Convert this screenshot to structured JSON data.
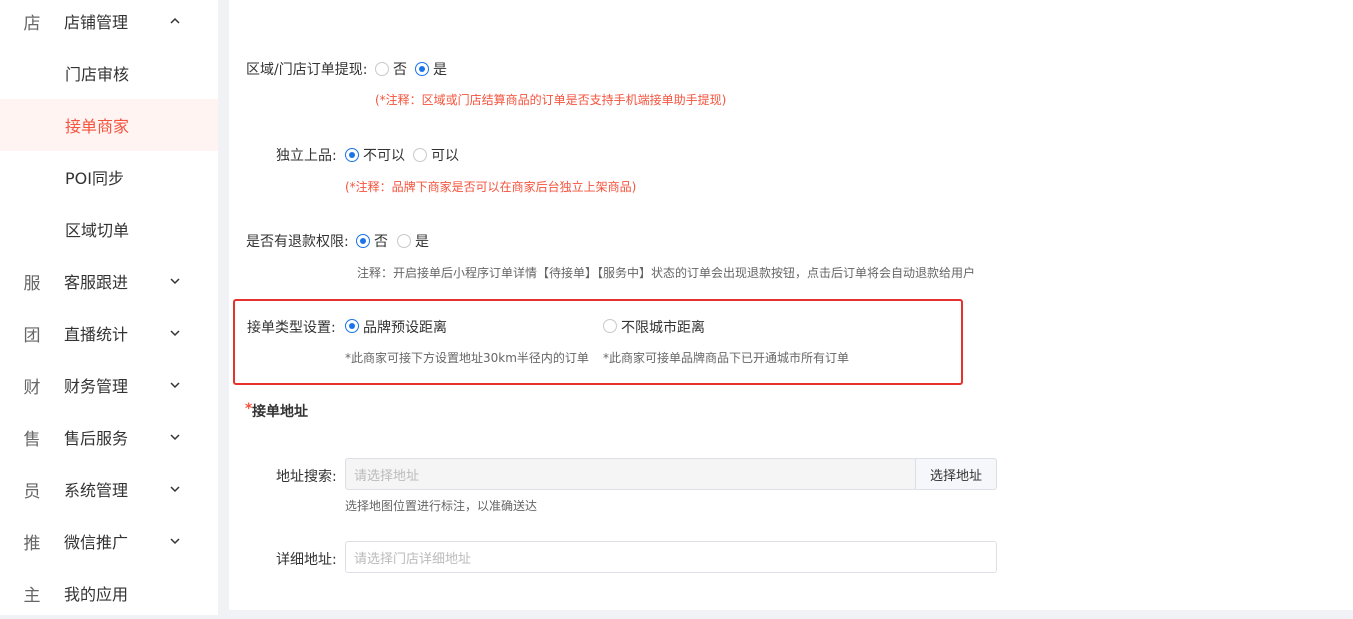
{
  "sidebar": {
    "items": [
      {
        "glyph": "店",
        "label": "店铺管理",
        "chevron": "up"
      },
      {
        "label": "门店审核"
      },
      {
        "label": "接单商家",
        "active": true
      },
      {
        "label": "POI同步"
      },
      {
        "label": "区域切单"
      },
      {
        "glyph": "服",
        "label": "客服跟进",
        "chevron": "down"
      },
      {
        "glyph": "团",
        "label": "直播统计",
        "chevron": "down"
      },
      {
        "glyph": "财",
        "label": "财务管理",
        "chevron": "down"
      },
      {
        "glyph": "售",
        "label": "售后服务",
        "chevron": "down"
      },
      {
        "glyph": "员",
        "label": "系统管理",
        "chevron": "down"
      },
      {
        "glyph": "推",
        "label": "微信推广",
        "chevron": "down"
      },
      {
        "glyph": "主",
        "label": "我的应用"
      }
    ]
  },
  "form": {
    "withdraw": {
      "label": "区域/门店订单提现:",
      "options": [
        "否",
        "是"
      ],
      "selected": "是",
      "note": "(*注释：区域或门店结算商品的订单是否支持手机端接单助手提现)"
    },
    "independent": {
      "label": "独立上品:",
      "options": [
        "不可以",
        "可以"
      ],
      "selected": "不可以",
      "note": "(*注释：品牌下商家是否可以在商家后台独立上架商品)"
    },
    "refund": {
      "label": "是否有退款权限:",
      "options": [
        "否",
        "是"
      ],
      "selected": "否",
      "note": "注释：开启接单后小程序订单详情【待接单】【服务中】状态的订单会出现退款按钮，点击后订单将会自动退款给用户"
    },
    "order_type": {
      "label": "接单类型设置:",
      "options": [
        "品牌预设距离",
        "不限城市距离"
      ],
      "selected": "品牌预设距离",
      "notes": [
        "*此商家可接下方设置地址30km半径内的订单",
        "*此商家可接单品牌商品下已开通城市所有订单"
      ]
    },
    "address_section": {
      "required_mark": "*",
      "title": "接单地址"
    },
    "address_search": {
      "label": "地址搜索:",
      "placeholder": "请选择地址",
      "button": "选择地址",
      "hint": "选择地图位置进行标注，以准确送达"
    },
    "address_detail": {
      "label": "详细地址:",
      "placeholder": "请选择门店详细地址"
    }
  },
  "colors": {
    "accent": "#f5533d",
    "radio": "#1a73e8",
    "highlight": "#e5322d"
  }
}
